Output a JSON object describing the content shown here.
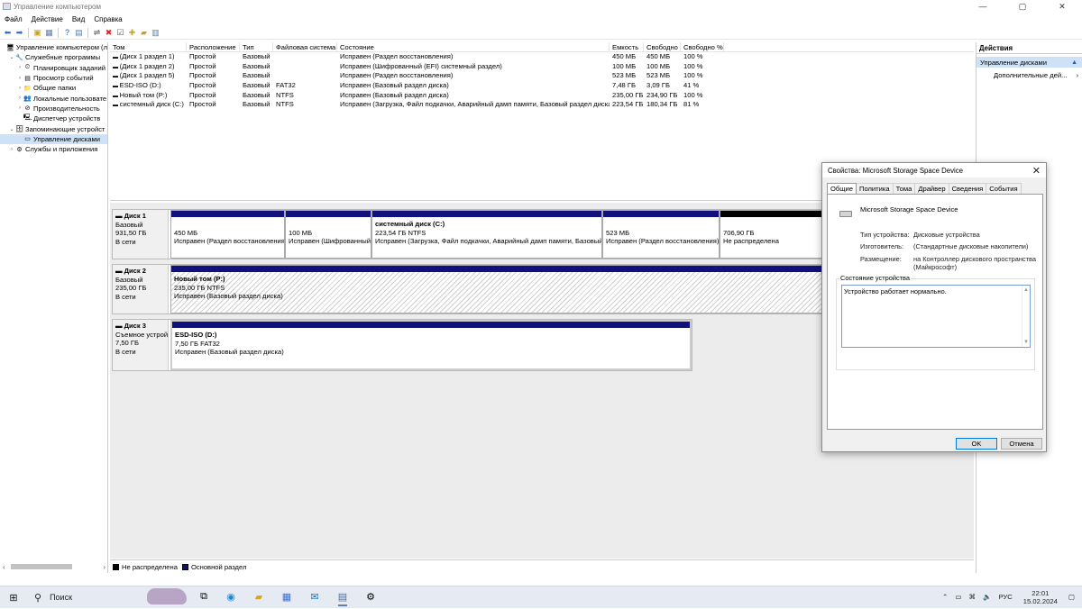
{
  "window": {
    "title": "Управление компьютером",
    "controls": [
      "—",
      "▢",
      "✕"
    ]
  },
  "menu": [
    "Файл",
    "Действие",
    "Вид",
    "Справка"
  ],
  "nav": {
    "items": [
      {
        "label": "Управление компьютером (л",
        "indent": 0,
        "arrow": "",
        "icon": "computer-icon",
        "glyph": "🖥"
      },
      {
        "label": "Служебные программы",
        "indent": 1,
        "arrow": "⌄",
        "icon": "tools-icon",
        "glyph": "🔧"
      },
      {
        "label": "Планировщик заданий",
        "indent": 2,
        "arrow": "›",
        "icon": "clock-icon",
        "glyph": "⏲"
      },
      {
        "label": "Просмотр событий",
        "indent": 2,
        "arrow": "›",
        "icon": "event-log-icon",
        "glyph": "▤"
      },
      {
        "label": "Общие папки",
        "indent": 2,
        "arrow": "›",
        "icon": "shared-folder-icon",
        "glyph": "📁"
      },
      {
        "label": "Локальные пользовате",
        "indent": 2,
        "arrow": "›",
        "icon": "users-icon",
        "glyph": "👥"
      },
      {
        "label": "Производительность",
        "indent": 2,
        "arrow": "›",
        "icon": "performance-icon",
        "glyph": "⊘"
      },
      {
        "label": "Диспетчер устройств",
        "indent": 2,
        "arrow": "",
        "icon": "device-manager-icon",
        "glyph": "🖳"
      },
      {
        "label": "Запоминающие устройст",
        "indent": 1,
        "arrow": "⌄",
        "icon": "storage-icon",
        "glyph": "🗄"
      },
      {
        "label": "Управление дисками",
        "indent": 2,
        "arrow": "",
        "icon": "disk-management-icon",
        "glyph": "▭",
        "selected": true
      },
      {
        "label": "Службы и приложения",
        "indent": 1,
        "arrow": "›",
        "icon": "services-icon",
        "glyph": "⚙"
      }
    ]
  },
  "volumes": {
    "headers": [
      "Том",
      "Расположение",
      "Тип",
      "Файловая система",
      "Состояние",
      "Емкость",
      "Свободно",
      "Свободно %"
    ],
    "rows": [
      [
        "(Диск 1 раздел 1)",
        "Простой",
        "Базовый",
        "",
        "Исправен (Раздел восстановления)",
        "450 МБ",
        "450 МБ",
        "100 %"
      ],
      [
        "(Диск 1 раздел 2)",
        "Простой",
        "Базовый",
        "",
        "Исправен (Шифрованный (EFI) системный раздел)",
        "100 МБ",
        "100 МБ",
        "100 %"
      ],
      [
        "(Диск 1 раздел 5)",
        "Простой",
        "Базовый",
        "",
        "Исправен (Раздел восстановления)",
        "523 МБ",
        "523 МБ",
        "100 %"
      ],
      [
        "ESD-ISO (D:)",
        "Простой",
        "Базовый",
        "FAT32",
        "Исправен (Базовый раздел диска)",
        "7,48 ГБ",
        "3,09 ГБ",
        "41 %"
      ],
      [
        "Новый том (P:)",
        "Простой",
        "Базовый",
        "NTFS",
        "Исправен (Базовый раздел диска)",
        "235,00 ГБ",
        "234,90 ГБ",
        "100 %"
      ],
      [
        "системный диск (C:)",
        "Простой",
        "Базовый",
        "NTFS",
        "Исправен (Загрузка, Файл подкачки, Аварийный дамп памяти, Базовый раздел диска)",
        "223,54 ГБ",
        "180,34 ГБ",
        "81 %"
      ]
    ]
  },
  "disks": {
    "d1": {
      "name": "Диск 1",
      "type": "Базовый",
      "size": "931,50 ГБ",
      "status": "В сети",
      "parts": [
        {
          "title": "",
          "size": "450 МБ",
          "status": "Исправен (Раздел восстановления)"
        },
        {
          "title": "",
          "size": "100 МБ",
          "status": "Исправен (Шифрованный (EFI) системный раздел)"
        },
        {
          "title": "системный диск  (C:)",
          "size": "223,54 ГБ NTFS",
          "status": "Исправен (Загрузка, Файл подкачки, Аварийный дамп памяти, Базовый раздел диска)"
        },
        {
          "title": "",
          "size": "523 МБ",
          "status": "Исправен (Раздел восстановления)"
        },
        {
          "title": "",
          "size": "706,90 ГБ",
          "status": "Не распределена"
        }
      ]
    },
    "d2": {
      "name": "Диск 2",
      "type": "Базовый",
      "size": "235,00 ГБ",
      "status": "В сети",
      "parts": [
        {
          "title": "Новый том  (P:)",
          "size": "235,00 ГБ NTFS",
          "status": "Исправен (Базовый раздел диска)"
        }
      ]
    },
    "d3": {
      "name": "Диск 3",
      "type": "Съемное устройство",
      "size": "7,50 ГБ",
      "status": "В сети",
      "parts": [
        {
          "title": "ESD-ISO  (D:)",
          "size": "7,50 ГБ FAT32",
          "status": "Исправен (Базовый раздел диска)"
        }
      ]
    }
  },
  "legend": {
    "unallocated": "Не распределена",
    "primary": "Основной раздел",
    "colors": {
      "unallocated": "#000000",
      "primary": "#10107f"
    }
  },
  "actions": {
    "header": "Действия",
    "section": "Управление дисками",
    "item": "Дополнительные дей..."
  },
  "dialog": {
    "title": "Свойства: Microsoft Storage Space Device",
    "tabs": [
      "Общие",
      "Политика",
      "Тома",
      "Драйвер",
      "Сведения",
      "События"
    ],
    "device_name": "Microsoft Storage Space Device",
    "props": [
      {
        "label": "Тип устройства:",
        "value": "Дисковые устройства"
      },
      {
        "label": "Изготовитель:",
        "value": "(Стандартные дисковые накопители)"
      },
      {
        "label": "Размещение:",
        "value": "на Контроллер дискового пространства (Майкрософт)"
      }
    ],
    "status_label": "Состояние устройства",
    "status_text": "Устройство работает нормально.",
    "ok": "OK",
    "cancel": "Отмена"
  },
  "taskbar": {
    "search": "Поиск",
    "lang": "РУС",
    "time": "22:01",
    "date": "15.02.2024"
  }
}
